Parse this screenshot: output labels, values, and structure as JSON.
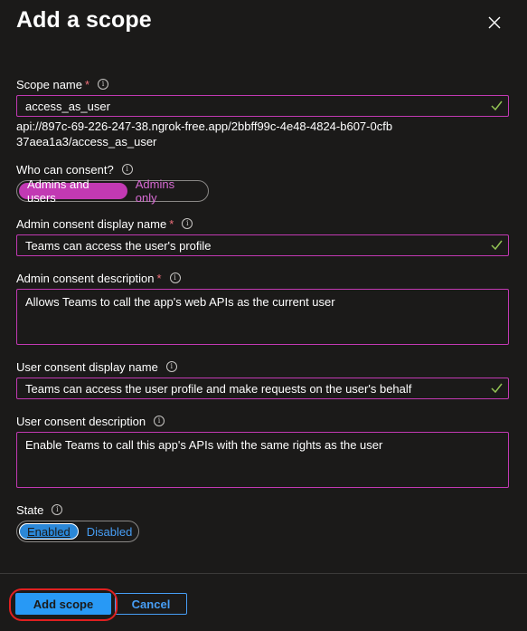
{
  "panel": {
    "title": "Add a scope",
    "close_icon": "close-icon"
  },
  "scope_name": {
    "label": "Scope name",
    "required_mark": "*",
    "value": "access_as_user",
    "valid": true
  },
  "scope_uri": "api://897c-69-226-247-38.ngrok-free.app/2bbff99c-4e48-4824-b607-0cfb37aea1a3/access_as_user",
  "who_can_consent": {
    "label": "Who can consent?",
    "options": [
      "Admins and users",
      "Admins only"
    ],
    "selected": "Admins and users"
  },
  "admin_consent_display_name": {
    "label": "Admin consent display name",
    "required_mark": "*",
    "value": "Teams can access the user's profile",
    "valid": true
  },
  "admin_consent_description": {
    "label": "Admin consent description",
    "required_mark": "*",
    "value": "Allows Teams to call the app's web APIs as the current user"
  },
  "user_consent_display_name": {
    "label": "User consent display name",
    "value": "Teams can access the user profile and make requests on the user's behalf",
    "valid": true
  },
  "user_consent_description": {
    "label": "User consent description",
    "value": "Enable Teams to call this app's APIs with the same rights as the user"
  },
  "state": {
    "label": "State",
    "options": [
      "Enabled",
      "Disabled"
    ],
    "selected": "Enabled"
  },
  "footer": {
    "add_scope_label": "Add scope",
    "cancel_label": "Cancel"
  },
  "info_glyph": "i",
  "colors": {
    "background": "#1b1a19",
    "accent_magenta": "#c239b3",
    "accent_blue": "#2899f5",
    "valid_check": "#92c353",
    "required_red": "#f1707b",
    "annotation_ring": "#e02020"
  }
}
